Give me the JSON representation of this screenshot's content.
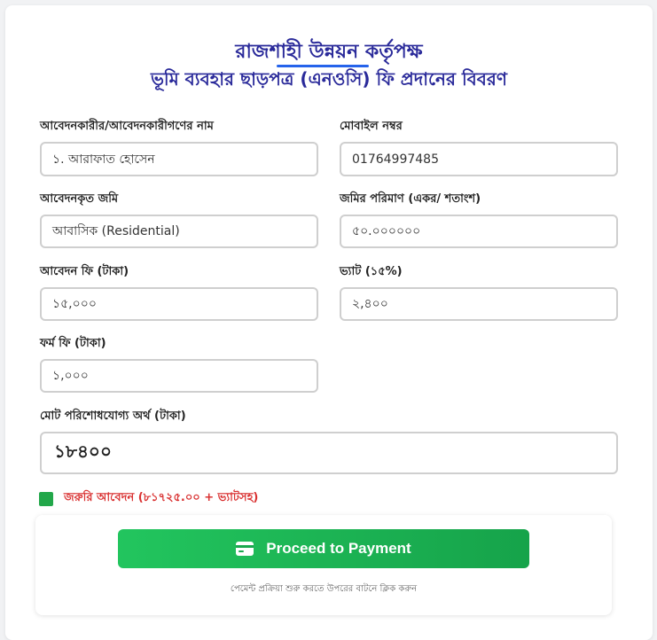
{
  "header": {
    "title": "রাজশাহী উন্নয়ন কর্তৃপক্ষ",
    "subtitle": "ভূমি ব্যবহার ছাড়পত্র (এনওসি) ফি প্রদানের বিবরণ"
  },
  "form": {
    "applicant_name": {
      "label": "আবেদনকারীর/আবেদনকারীগণের নাম",
      "value": "১. আরাফাত হোসেন"
    },
    "mobile": {
      "label": "মোবাইল নম্বর",
      "value": "01764997485"
    },
    "land_type": {
      "label": "আবেদনকৃত জমি",
      "value": "আবাসিক (Residential)"
    },
    "land_area": {
      "label": "জমির পরিমাণ (একর/ শতাংশ)",
      "value": "৫০.০০০০০০"
    },
    "application_fee": {
      "label": "আবেদন ফি (টাকা)",
      "value": "১৫,০০০"
    },
    "vat": {
      "label": "ভ্যাট (১৫%)",
      "value": "২,৪০০"
    },
    "form_fee": {
      "label": "ফর্ম ফি (টাকা)",
      "value": "১,০০০"
    },
    "total": {
      "label": "মোট পরিশোধযোগ্য অর্থ (টাকা)",
      "value": "১৮৪০০"
    }
  },
  "urgent": {
    "label": "জরুরি আবেদন (৮১৭২৫.০০ + ভ্যাটসহ)",
    "checked": true,
    "color": "#22a74a"
  },
  "payment": {
    "button_label": "Proceed to Payment",
    "button_icon": "credit-card-icon",
    "hint": "পেমেন্ট প্রক্রিয়া শুরু করতে উপরের বাটনে ক্লিক করুন",
    "accent": "#16a34a"
  }
}
